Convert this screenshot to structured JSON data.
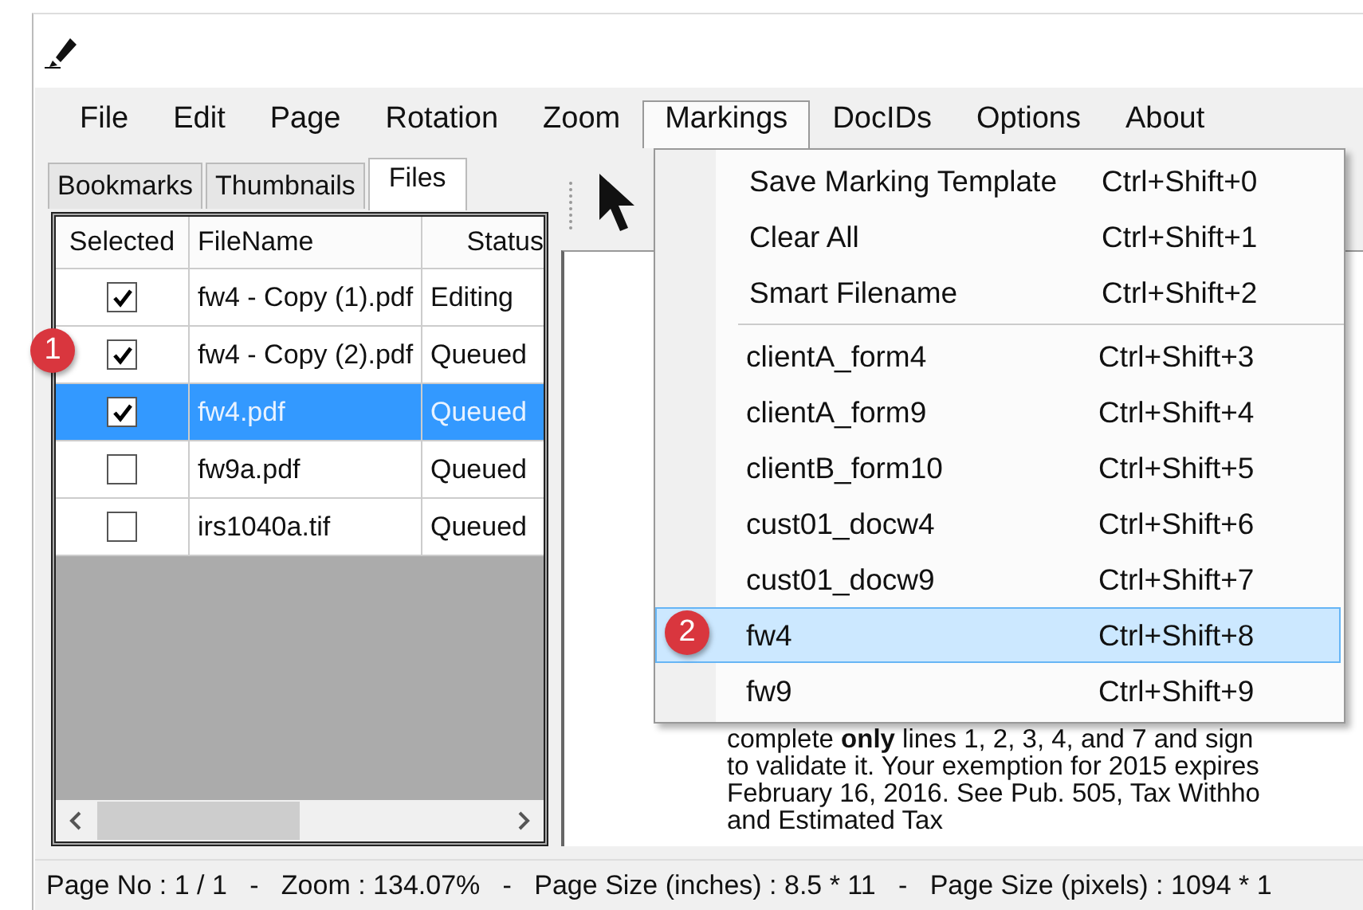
{
  "menu_bar": [
    {
      "label": "File",
      "selected": false
    },
    {
      "label": "Edit",
      "selected": false
    },
    {
      "label": "Page",
      "selected": false
    },
    {
      "label": "Rotation",
      "selected": false
    },
    {
      "label": "Zoom",
      "selected": false
    },
    {
      "label": "Markings",
      "selected": true
    },
    {
      "label": "DocIDs",
      "selected": false
    },
    {
      "label": "Options",
      "selected": false
    },
    {
      "label": "About",
      "selected": false
    }
  ],
  "panel_tabs": [
    {
      "label": "Bookmarks",
      "selected": false
    },
    {
      "label": "Thumbnails",
      "selected": false
    },
    {
      "label": "Files",
      "selected": true
    }
  ],
  "files_table": {
    "columns": [
      "Selected",
      "FileName",
      "Status"
    ],
    "rows": [
      {
        "checked": true,
        "file_name": "fw4 - Copy (1).pdf",
        "status": "Editing",
        "selected": false
      },
      {
        "checked": true,
        "file_name": "fw4 - Copy (2).pdf",
        "status": "Queued",
        "selected": false,
        "badge": "1"
      },
      {
        "checked": true,
        "file_name": "fw4.pdf",
        "status": "Queued",
        "selected": true
      },
      {
        "checked": false,
        "file_name": "fw9a.pdf",
        "status": "Queued",
        "selected": false
      },
      {
        "checked": false,
        "file_name": "irs1040a.tif",
        "status": "Queued",
        "selected": false
      }
    ]
  },
  "document_text": [
    "complete **only** lines 1, 2, 3, 4, and 7 and sign",
    "to validate it. Your exemption for 2015 expires",
    "February 16, 2016. See Pub. 505, Tax Withho",
    "and Estimated Tax"
  ],
  "markings_menu": [
    [
      {
        "label": "Save Marking Template",
        "shortcut": "Ctrl+Shift+0",
        "selected": false
      },
      {
        "label": "Clear All",
        "shortcut": "Ctrl+Shift+1",
        "selected": false
      },
      {
        "label": "Smart Filename",
        "shortcut": "Ctrl+Shift+2",
        "selected": false
      }
    ],
    [
      {
        "label": "clientA_form4",
        "shortcut": "Ctrl+Shift+3",
        "selected": false
      },
      {
        "label": "clientA_form9",
        "shortcut": "Ctrl+Shift+4",
        "selected": false
      },
      {
        "label": "clientB_form10",
        "shortcut": "Ctrl+Shift+5",
        "selected": false
      },
      {
        "label": "cust01_docw4",
        "shortcut": "Ctrl+Shift+6",
        "selected": false
      },
      {
        "label": "cust01_docw9",
        "shortcut": "Ctrl+Shift+7",
        "selected": false
      },
      {
        "label": "fw4",
        "shortcut": "Ctrl+Shift+8",
        "selected": true,
        "badge": "2"
      },
      {
        "label": "fw9",
        "shortcut": "Ctrl+Shift+9",
        "selected": false
      }
    ]
  ],
  "status_bar": "Page No : 1 / 1   -   Zoom : 134.07%   -   Page Size (inches) : 8.5 * 11   -   Page Size (pixels) : 1094 * 1"
}
